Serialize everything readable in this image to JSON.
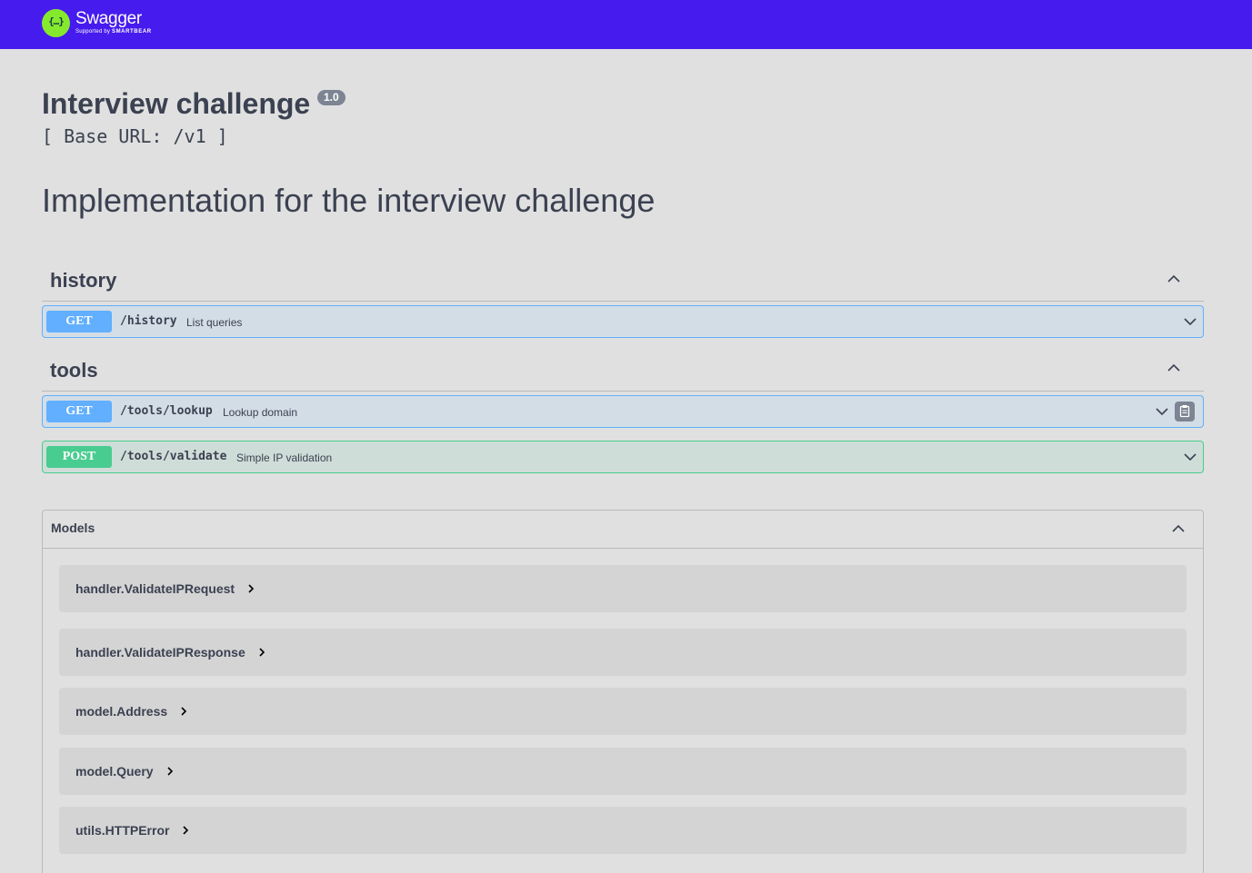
{
  "topbar": {
    "logo_glyph": "{…}",
    "logo_title": "Swagger",
    "logo_sub_prefix": "Supported by",
    "logo_sub_brand": "SMARTBEAR",
    "background": "#461bee"
  },
  "info": {
    "title": "Interview challenge",
    "version": "1.0",
    "base_url": "[ Base URL: /v1 ]",
    "description": "Implementation for the interview challenge"
  },
  "tags": [
    {
      "name": "history",
      "operations": [
        {
          "method": "GET",
          "path": "/history",
          "summary": "List queries"
        }
      ]
    },
    {
      "name": "tools",
      "operations": [
        {
          "method": "GET",
          "path": "/tools/lookup",
          "summary": "Lookup domain"
        },
        {
          "method": "POST",
          "path": "/tools/validate",
          "summary": "Simple IP validation"
        }
      ]
    }
  ],
  "models": {
    "title": "Models",
    "items": [
      "handler.ValidateIPRequest",
      "handler.ValidateIPResponse",
      "model.Address",
      "model.Query",
      "utils.HTTPError"
    ]
  },
  "colors": {
    "get": "#61affe",
    "post": "#49cc90",
    "logo_green": "#85ea2d"
  }
}
